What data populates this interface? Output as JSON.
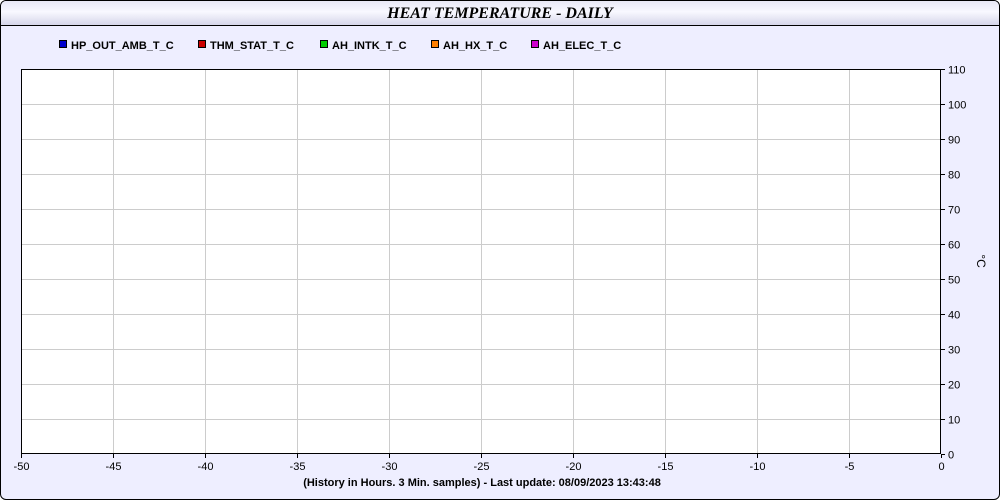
{
  "chart_data": {
    "type": "line",
    "title": "HEAT TEMPERATURE - DAILY",
    "xlabel": "(History in Hours. 3 Min. samples) - Last update: 08/09/2023 13:43:48",
    "ylabel": "°C",
    "x_ticks": [
      -50,
      -45,
      -40,
      -35,
      -30,
      -25,
      -20,
      -15,
      -10,
      -5,
      0
    ],
    "y_ticks": [
      0,
      10,
      20,
      30,
      40,
      50,
      60,
      70,
      80,
      90,
      100,
      110
    ],
    "xlim": [
      -50,
      0
    ],
    "ylim": [
      0,
      110
    ],
    "grid": true,
    "legend_position": "top-left",
    "y_axis_side": "right",
    "series": [
      {
        "name": "HP_OUT_AMB_T_C",
        "color": "#0000cc",
        "values": []
      },
      {
        "name": "THM_STAT_T_C",
        "color": "#cc0000",
        "values": []
      },
      {
        "name": "AH_INTK_T_C",
        "color": "#00cc00",
        "values": []
      },
      {
        "name": "AH_HX_T_C",
        "color": "#ff7f00",
        "values": []
      },
      {
        "name": "AH_ELEC_T_C",
        "color": "#cc00cc",
        "values": []
      }
    ]
  }
}
